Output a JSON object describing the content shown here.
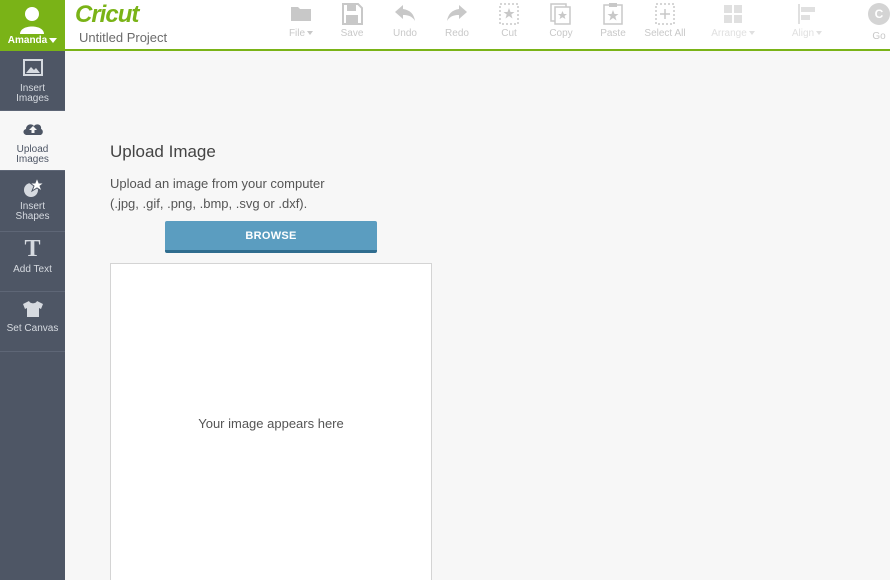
{
  "user": {
    "name": "Amanda"
  },
  "sidebar": {
    "items": [
      {
        "label": "Insert Images",
        "icon": "image-icon"
      },
      {
        "label": "Upload Images",
        "icon": "cloud-upload-icon",
        "active": true
      },
      {
        "label": "Insert Shapes",
        "icon": "shapes-icon"
      },
      {
        "label": "Add Text",
        "icon": "text-icon"
      },
      {
        "label": "Set Canvas",
        "icon": "tshirt-icon"
      }
    ]
  },
  "header": {
    "logo": "Cricut",
    "project_title": "Untitled Project",
    "toolbar": [
      {
        "label": "File",
        "icon": "folder-icon"
      },
      {
        "label": "Save",
        "icon": "save-icon"
      },
      {
        "label": "Undo",
        "icon": "undo-icon"
      },
      {
        "label": "Redo",
        "icon": "redo-icon"
      },
      {
        "label": "Cut",
        "icon": "cut-icon"
      },
      {
        "label": "Copy",
        "icon": "copy-icon"
      },
      {
        "label": "Paste",
        "icon": "paste-icon"
      },
      {
        "label": "Select All",
        "icon": "select-all-icon"
      },
      {
        "label": "Arrange",
        "icon": "arrange-icon"
      },
      {
        "label": "Align",
        "icon": "align-icon"
      }
    ],
    "go": {
      "label": "Go",
      "badge": "C"
    }
  },
  "upload": {
    "title": "Upload Image",
    "desc_line1": "Upload an image from your computer",
    "desc_line2": "(.jpg, .gif, .png, .bmp, .svg or .dxf).",
    "browse_label": "BROWSE",
    "placeholder": "Your image appears here"
  },
  "colors": {
    "brand_green": "#7ab317",
    "sidebar_bg": "#4e5665",
    "browse_blue": "#5b9dc0"
  }
}
